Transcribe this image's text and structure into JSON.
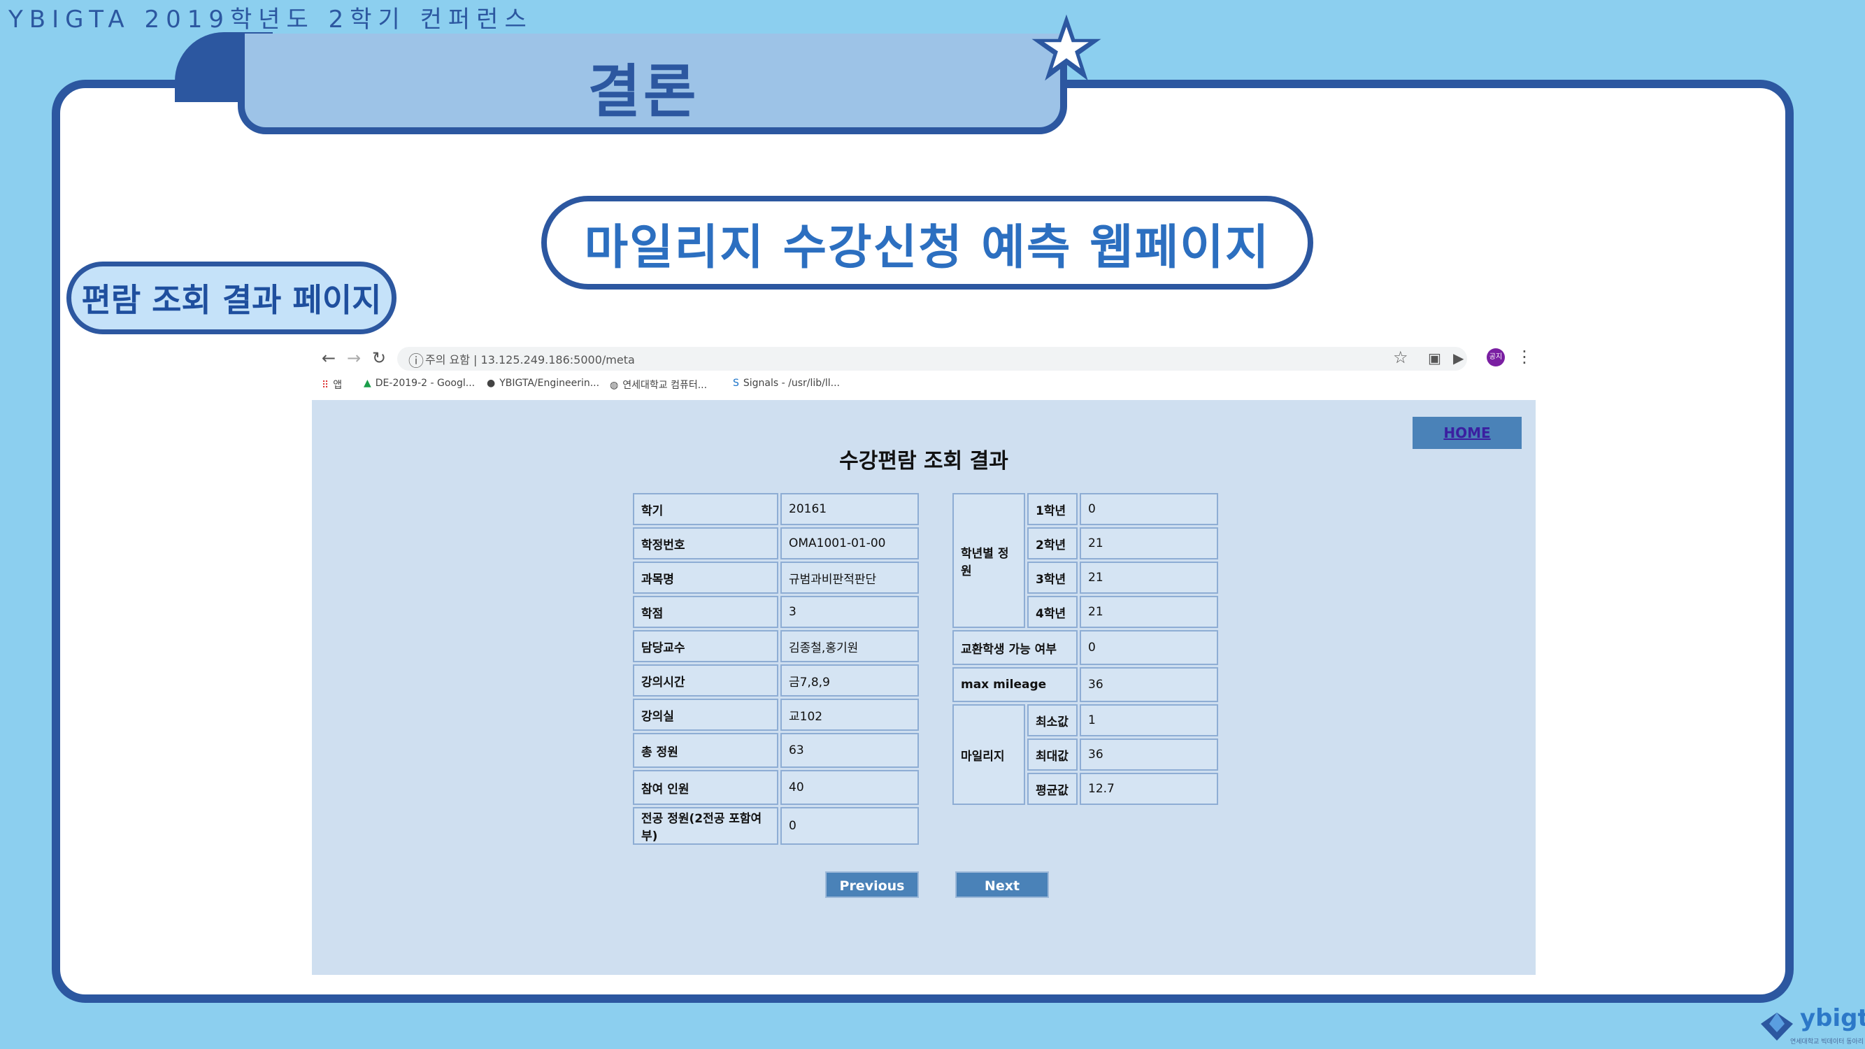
{
  "conference": "YBIGTA 2019학년도 2학기 컨퍼런스",
  "section_title": "결론",
  "main_pill": "마일리지 수강신청 예측 웹페이지",
  "side_pill": "편람 조회 결과 페이지",
  "browser": {
    "url_security": "주의 요함",
    "url": "13.125.249.186:5000/meta",
    "bookmarks": [
      "앱",
      "DE-2019-2 - Googl...",
      "YBIGTA/Engineerin...",
      "연세대학교 컴퓨터...",
      "Signals - /usr/lib/ll..."
    ],
    "avatar_label": "공지"
  },
  "page": {
    "home_label": "HOME",
    "title": "수강편람 조회 결과",
    "left_table": [
      {
        "label": "학기",
        "value": "20161"
      },
      {
        "label": "학정번호",
        "value": "OMA1001-01-00"
      },
      {
        "label": "과목명",
        "value": "규범과비판적판단"
      },
      {
        "label": "학점",
        "value": "3"
      },
      {
        "label": "담당교수",
        "value": "김종철,홍기원"
      },
      {
        "label": "강의시간",
        "value": "금7,8,9"
      },
      {
        "label": "강의실",
        "value": "교102"
      },
      {
        "label": "총 정원",
        "value": "63"
      },
      {
        "label": "참여 인원",
        "value": "40"
      },
      {
        "label": "전공 정원(2전공 포함여부)",
        "value": "0"
      }
    ],
    "right_table": {
      "grade_group": "학년별 정원",
      "grades": [
        {
          "label": "1학년",
          "value": "0"
        },
        {
          "label": "2학년",
          "value": "21"
        },
        {
          "label": "3학년",
          "value": "21"
        },
        {
          "label": "4학년",
          "value": "21"
        }
      ],
      "exchange_label": "교환학생 가능 여부",
      "exchange_value": "0",
      "max_label": "max mileage",
      "max_value": "36",
      "mileage_group": "마일리지",
      "mileage": [
        {
          "label": "최소값",
          "value": "1"
        },
        {
          "label": "최대값",
          "value": "36"
        },
        {
          "label": "평균값",
          "value": "12.7"
        }
      ]
    },
    "prev_label": "Previous",
    "next_label": "Next"
  },
  "logo": {
    "name": "ybigta",
    "subtitle": "연세대학교 빅데이터 동아리"
  }
}
